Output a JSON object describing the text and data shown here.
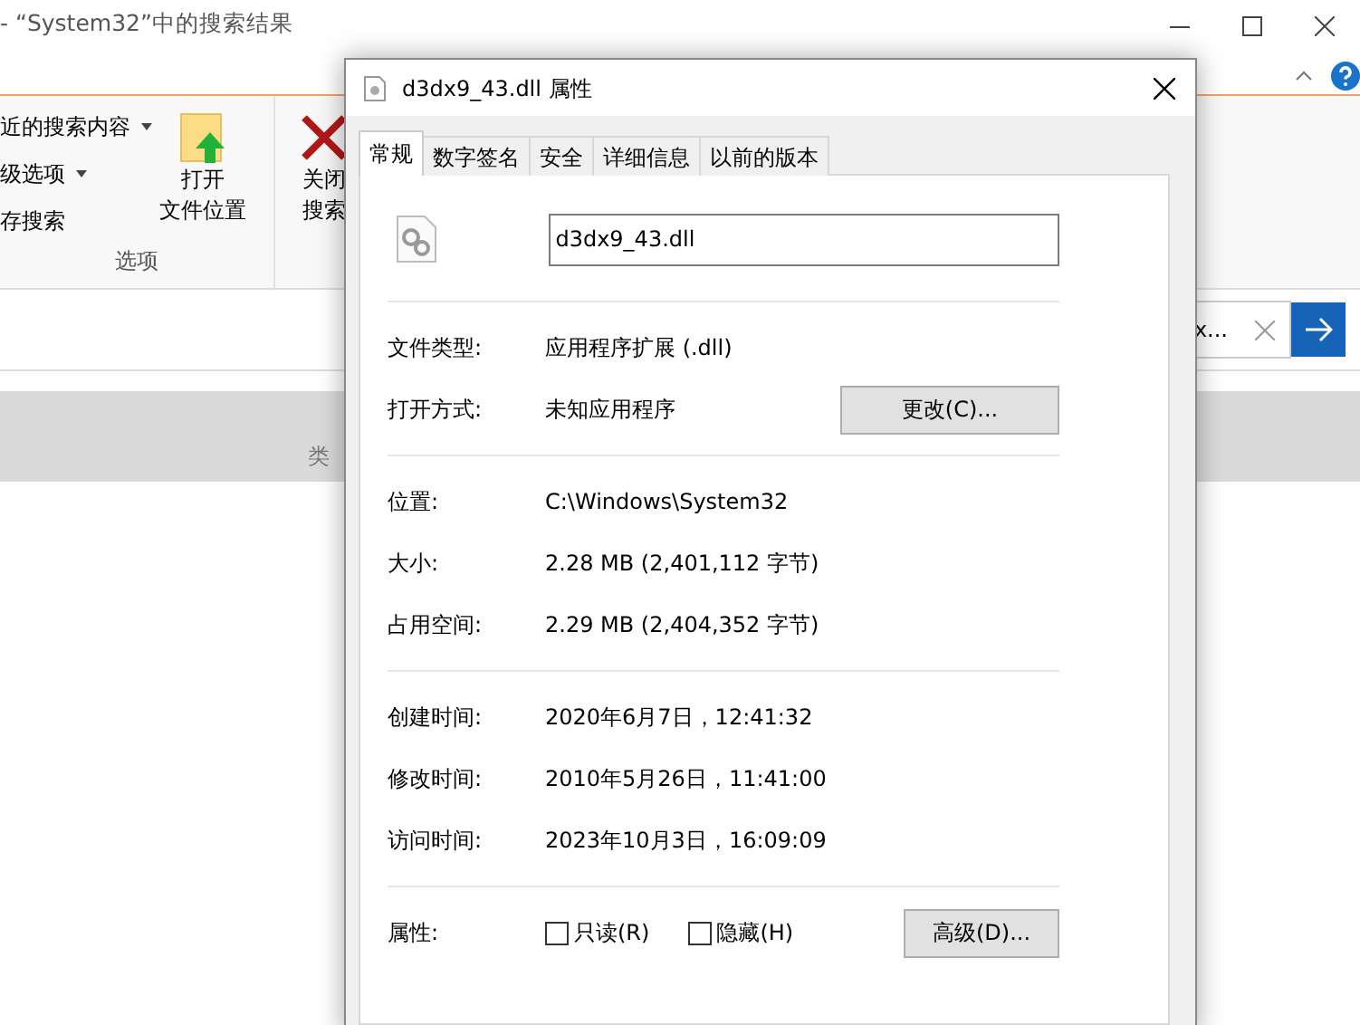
{
  "explorer": {
    "title": "- “System32”中的搜索结果",
    "ribbon_options": [
      {
        "label": "近的搜索内容",
        "has_menu": true
      },
      {
        "label": "级选项",
        "has_menu": true
      },
      {
        "label": "存搜索",
        "has_menu": false
      }
    ],
    "group_label": "选项",
    "ribbon_buttons": [
      {
        "kind": "open",
        "lines": [
          "打开",
          "文件位置"
        ]
      },
      {
        "kind": "close",
        "lines": [
          "关闭",
          "搜索"
        ]
      }
    ],
    "search_value": "x...",
    "column_header": "类"
  },
  "dialog": {
    "title": "d3dx9_43.dll 属性",
    "tabs": [
      {
        "label": "常规",
        "selected": true
      },
      {
        "label": "数字签名",
        "selected": false
      },
      {
        "label": "安全",
        "selected": false
      },
      {
        "label": "详细信息",
        "selected": false
      },
      {
        "label": "以前的版本",
        "selected": false
      }
    ],
    "file_name": "d3dx9_43.dll",
    "sections": [
      [
        {
          "label": "文件类型:",
          "value": "应用程序扩展 (.dll)"
        },
        {
          "label": "打开方式:",
          "value": "未知应用程序",
          "button": "更改(C)..."
        }
      ],
      [
        {
          "label": "位置:",
          "value": "C:\\Windows\\System32"
        },
        {
          "label": "大小:",
          "value": "2.28 MB (2,401,112 字节)"
        },
        {
          "label": "占用空间:",
          "value": "2.29 MB (2,404,352 字节)"
        }
      ],
      [
        {
          "label": "创建时间:",
          "value": "2020年6月7日，12:41:32"
        },
        {
          "label": "修改时间:",
          "value": "2010年5月26日，11:41:00"
        },
        {
          "label": "访问时间:",
          "value": "2023年10月3日，16:09:09"
        }
      ]
    ],
    "attributes": {
      "label": "属性:",
      "checkboxes": [
        {
          "label": "只读(R)",
          "checked": false
        },
        {
          "label": "隐藏(H)",
          "checked": false
        }
      ],
      "button": "高级(D)..."
    }
  }
}
